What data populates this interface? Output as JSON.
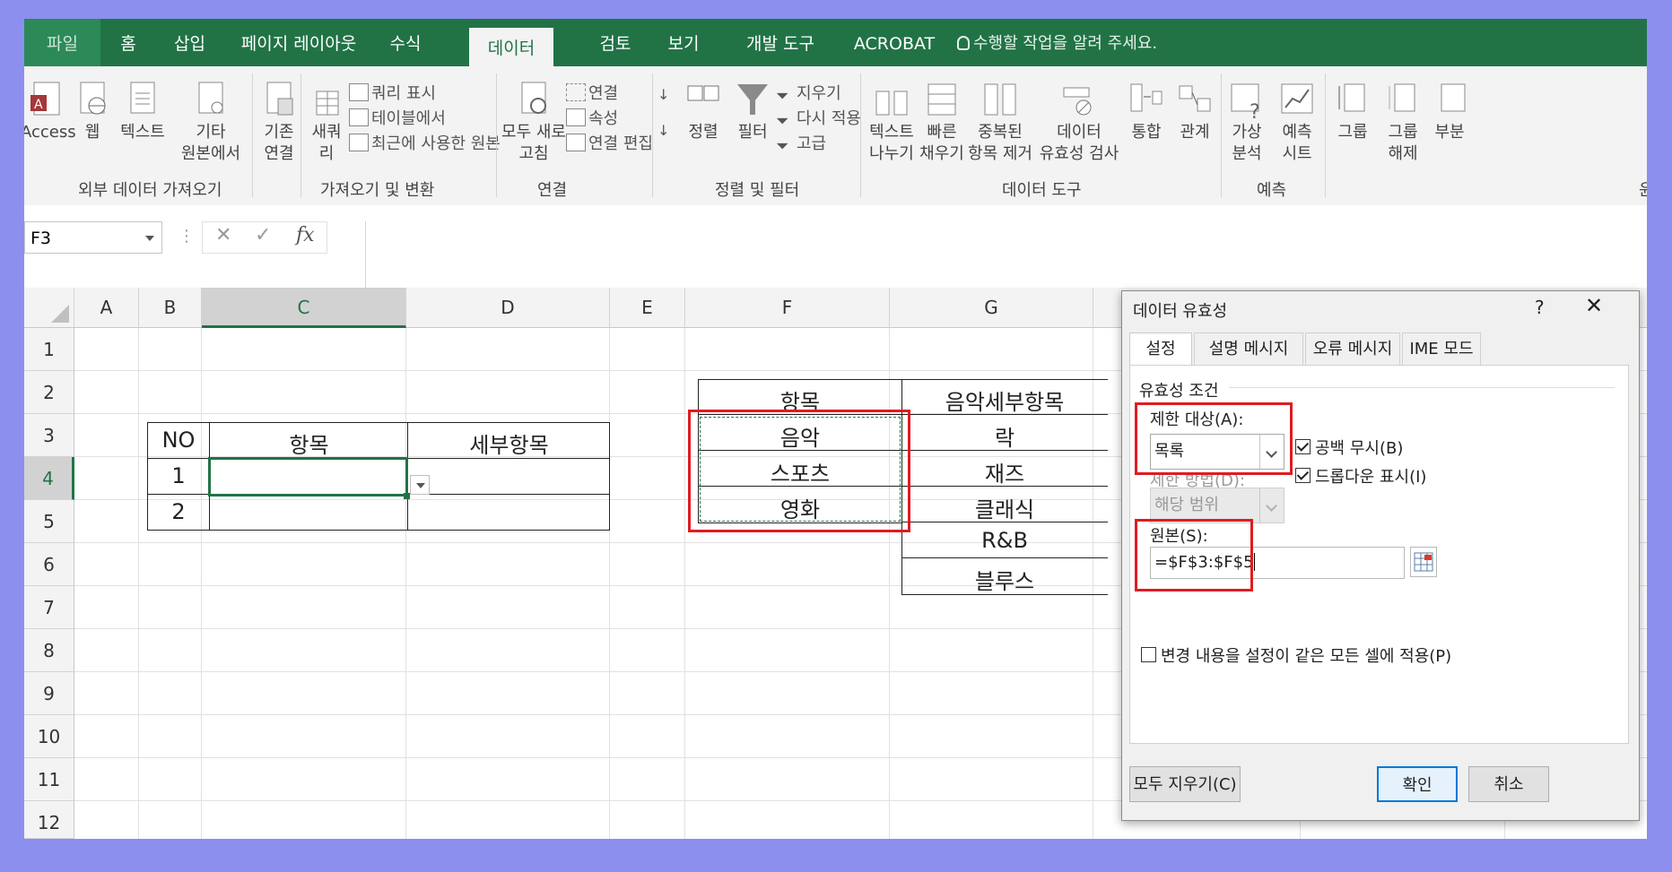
{
  "tabs": [
    "파일",
    "홈",
    "삽입",
    "페이지 레이아웃",
    "수식",
    "데이터",
    "검토",
    "보기",
    "개발 도구",
    "ACROBAT"
  ],
  "tell_me": "수행할 작업을 알려 주세요.",
  "ribbon": {
    "access": "Access",
    "web": "웹",
    "text": "텍스트",
    "other_1": "기타",
    "other_2": "원본에서",
    "existing_1": "기존",
    "existing_2": "연결",
    "new_query_1": "새쿼",
    "new_query_2": "리",
    "show_queries": "쿼리 표시",
    "from_table": "테이블에서",
    "recent_sources": "최근에 사용한 원본",
    "refresh_1": "모두 새로",
    "refresh_2": "고침",
    "connections": "연결",
    "properties": "속성",
    "edit_links": "연결 편집",
    "sort": "정렬",
    "filter": "필터",
    "clear": "지우기",
    "reapply": "다시 적용",
    "advanced": "고급",
    "text_to_columns_1": "텍스트",
    "text_to_columns_2": "나누기",
    "flash_fill_1": "빠른",
    "flash_fill_2": "채우기",
    "remove_dup_1": "중복된",
    "remove_dup_2": "항목 제거",
    "data_validation_1": "데이터",
    "data_validation_2": "유효성 검사",
    "consolidate": "통합",
    "relationships": "관계",
    "whatif_1": "가상",
    "whatif_2": "분석",
    "forecast_1": "예측",
    "forecast_2": "시트",
    "group": "그룹",
    "ungroup_1": "그룹",
    "ungroup_2": "해제",
    "subtotal": "부분",
    "groups": [
      "외부 데이터 가져오기",
      "가져오기 및 변환",
      "연결",
      "정렬 및 필터",
      "데이터 도구",
      "예측",
      "윤"
    ]
  },
  "name_box": "F3",
  "columns": [
    "A",
    "B",
    "C",
    "D",
    "E",
    "F",
    "G"
  ],
  "rows": [
    "1",
    "2",
    "3",
    "4",
    "5",
    "6",
    "7",
    "8",
    "9",
    "10",
    "11",
    "12"
  ],
  "sheet": {
    "no_header": "NO",
    "item_header": "항목",
    "sub_header": "세부항목",
    "row1": "1",
    "row2": "2",
    "f_header": "항목",
    "g_header": "음악세부항목",
    "f_values": [
      "음악",
      "스포츠",
      "영화"
    ],
    "g_values": [
      "락",
      "재즈",
      "클래식",
      "R&B",
      "블루스"
    ]
  },
  "dialog": {
    "title": "데이터 유효성",
    "help": "?",
    "close": "✕",
    "tabs": [
      "설정",
      "설명 메시지",
      "오류 메시지",
      "IME 모드"
    ],
    "criteria_label": "유효성 조건",
    "allow_label": "제한 대상(A):",
    "allow_value": "목록",
    "data_label": "제한 방법(D):",
    "data_value": "해당 범위",
    "ignore_blank": "공백 무시(B)",
    "dropdown": "드롭다운 표시(I)",
    "source_label": "원본(S):",
    "source_value": "=$F$3:$F$5",
    "apply_all": "변경 내용을 설정이 같은 모든 셀에 적용(P)",
    "clear_all": "모두 지우기(C)",
    "ok": "확인",
    "cancel": "취소"
  },
  "colors": {
    "excel_green": "#217346",
    "highlight_red": "#e01b22",
    "frame": "#8c8fee"
  }
}
